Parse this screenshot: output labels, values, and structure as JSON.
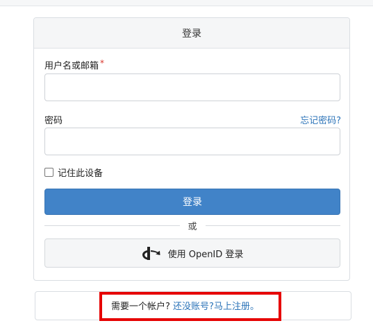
{
  "login": {
    "header_title": "登录",
    "username_label": "用户名或邮箱",
    "required_mark": "*",
    "username_value": "",
    "password_label": "密码",
    "password_value": "",
    "forgot_password_link": "忘记密码?",
    "remember_label": "记住此设备",
    "remember_checked": false,
    "submit_button": "登录",
    "divider_text": "或",
    "openid_button": "使用 OpenID 登录",
    "openid_icon": "openid-icon"
  },
  "register": {
    "prompt": "需要一个帐户?",
    "link_text": "还没账号?马上注册。"
  },
  "colors": {
    "primary_button": "#4183c8",
    "link": "#2b73b8",
    "highlight_border": "#e60000",
    "required": "#d9352b"
  }
}
